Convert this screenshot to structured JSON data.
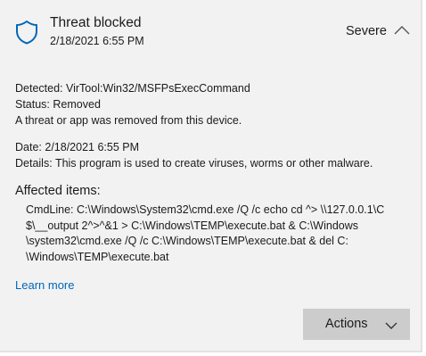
{
  "header": {
    "title": "Threat blocked",
    "timestamp": "2/18/2021 6:55 PM",
    "severity": "Severe",
    "shield_icon": "shield-icon",
    "collapse_icon": "chevron-up-icon",
    "shield_color": "#0067b8"
  },
  "details": {
    "detected_label": "Detected:",
    "detected_value": "VirTool:Win32/MSFPsExecCommand",
    "status_label": "Status:",
    "status_value": "Removed",
    "status_message": "A threat or app was removed from this device.",
    "date_label": "Date:",
    "date_value": "2/18/2021 6:55 PM",
    "details_label": "Details:",
    "details_value": "This program is used to create viruses, worms or other malware."
  },
  "affected": {
    "title": "Affected items:",
    "lines": [
      "CmdLine: C:\\Windows\\System32\\cmd.exe /Q /c echo cd ^> \\\\127.0.0.1\\C",
      "$\\__output 2^>^&1 > C:\\Windows\\TEMP\\execute.bat & C:\\Windows",
      "\\system32\\cmd.exe /Q /c C:\\Windows\\TEMP\\execute.bat & del C:",
      "\\Windows\\TEMP\\execute.bat"
    ]
  },
  "links": {
    "learn_more": "Learn more"
  },
  "actions": {
    "label": "Actions",
    "chevron_icon": "chevron-down-icon"
  },
  "colors": {
    "card_background": "#f2f2f2",
    "link": "#0067b8",
    "button_background": "#cccccc"
  }
}
